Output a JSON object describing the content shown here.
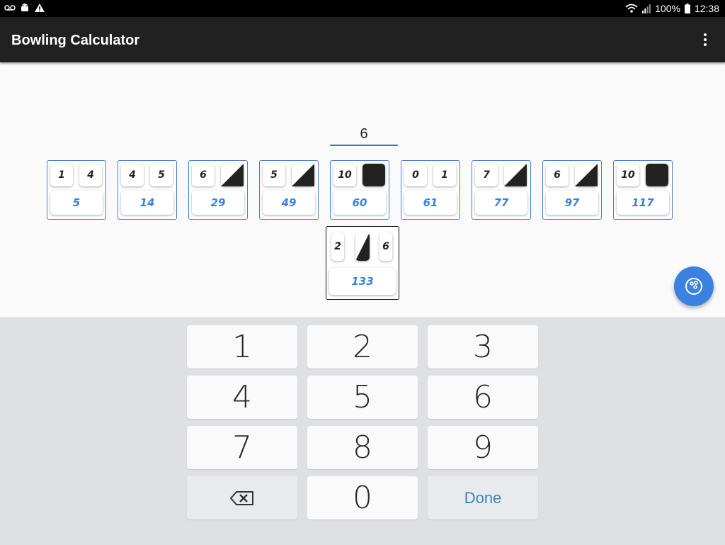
{
  "status_bar": {
    "battery": "100%",
    "time": "12:38",
    "left_icons": [
      "voicemail-icon",
      "android-icon",
      "warning-icon"
    ],
    "right_icons": [
      "wifi-icon",
      "signal-icon",
      "battery-icon"
    ]
  },
  "app": {
    "title": "Bowling Calculator",
    "menu_icon": "overflow-menu-icon"
  },
  "input": {
    "value": "6"
  },
  "frames": [
    {
      "roll1": "1",
      "roll2": "4",
      "roll2_mark": "none",
      "total": "5"
    },
    {
      "roll1": "4",
      "roll2": "5",
      "roll2_mark": "none",
      "total": "14"
    },
    {
      "roll1": "6",
      "roll2": "",
      "roll2_mark": "spare",
      "total": "29"
    },
    {
      "roll1": "5",
      "roll2": "",
      "roll2_mark": "spare",
      "total": "49"
    },
    {
      "roll1": "10",
      "roll2": "",
      "roll2_mark": "strike",
      "total": "60"
    },
    {
      "roll1": "0",
      "roll2": "1",
      "roll2_mark": "none",
      "total": "61"
    },
    {
      "roll1": "7",
      "roll2": "",
      "roll2_mark": "spare",
      "total": "77"
    },
    {
      "roll1": "6",
      "roll2": "",
      "roll2_mark": "spare",
      "total": "97"
    },
    {
      "roll1": "10",
      "roll2": "",
      "roll2_mark": "strike",
      "total": "117"
    }
  ],
  "tenth_frame": {
    "roll1": "2",
    "roll2_mark": "spare",
    "roll3": "6",
    "total": "133"
  },
  "keypad": {
    "keys": [
      "1",
      "2",
      "3",
      "4",
      "5",
      "6",
      "7",
      "8",
      "9"
    ],
    "backspace_icon": "backspace-icon",
    "zero": "0",
    "done": "Done"
  },
  "fab": {
    "icon": "bowling-ball-icon",
    "color": "#3b82e0"
  },
  "colors": {
    "app_bar": "#212121",
    "accent": "#3b82d6",
    "frame_border": "#4a7dc8"
  }
}
